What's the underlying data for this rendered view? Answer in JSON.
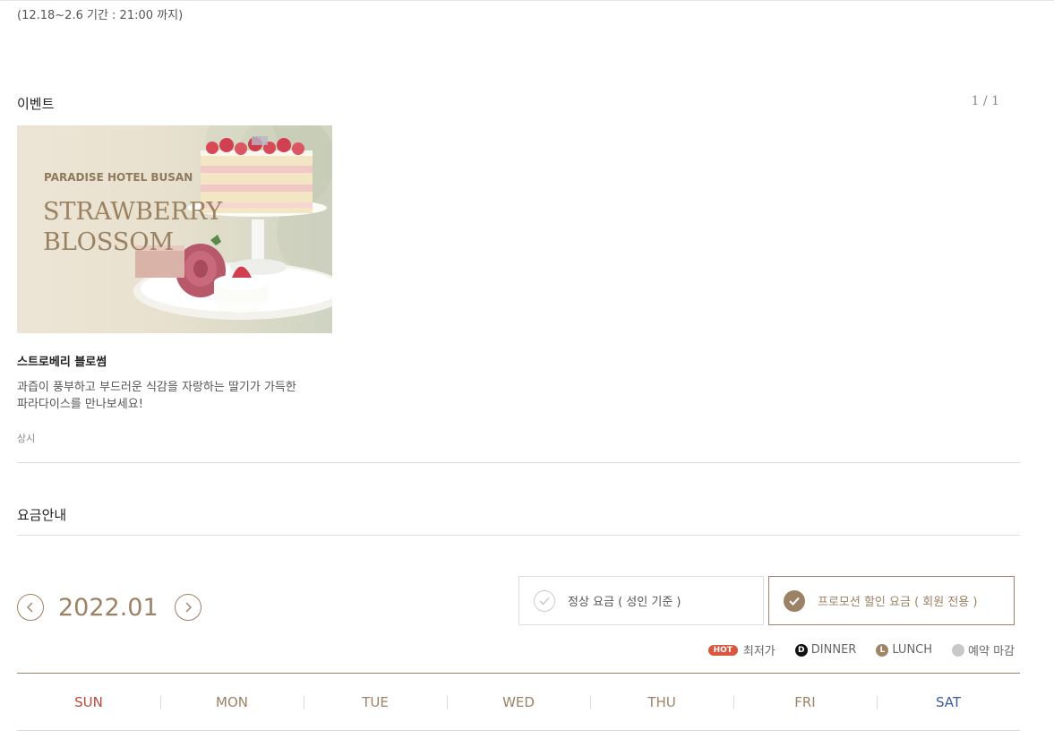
{
  "top_note": "(12.18~2.6 기간 : 21:00 까지)",
  "event_section": {
    "title": "이벤트",
    "paging": "1 / 1",
    "card": {
      "image_brand": "PARADISE HOTEL BUSAN",
      "image_title_line1": "STRAWBERRY",
      "image_title_line2": "BLOSSOM",
      "name": "스트로베리 블로썸",
      "desc_line1": "과즙이 풍부하고 부드러운 식감을 자랑하는 딸기가 가득한",
      "desc_line2": "파라다이스를 만나보세요!",
      "period": "상시"
    }
  },
  "rate_section": {
    "title": "요금안내",
    "month": "2022.01",
    "options": [
      {
        "label": "정상 요금 ( 성인 기준 )",
        "selected": false
      },
      {
        "label": "프로모션 할인 요금 ( 회원 전용 )",
        "selected": true
      }
    ],
    "legend": {
      "hot_badge": "HOT",
      "hot_label": "최저가",
      "dinner_mark": "D",
      "dinner_label": "DINNER",
      "lunch_mark": "L",
      "lunch_label": "LUNCH",
      "closed_label": "예약 마감"
    },
    "weekdays": [
      "SUN",
      "MON",
      "TUE",
      "WED",
      "THU",
      "FRI",
      "SAT"
    ]
  },
  "colors": {
    "accent": "#9c8265",
    "hot": "#d9573e",
    "sunday": "#c2473c",
    "saturday": "#3e5a9c"
  }
}
